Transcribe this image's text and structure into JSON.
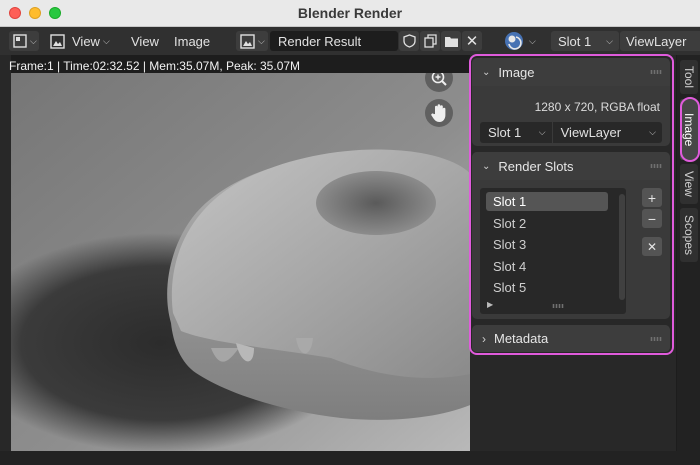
{
  "window": {
    "title": "Blender Render"
  },
  "header": {
    "view_menu": "View",
    "view_label": "View",
    "image_menu": "Image",
    "image_name": "Render Result",
    "slot": "Slot 1",
    "layer": "ViewLayer"
  },
  "status": {
    "text": "Frame:1 | Time:02:32.52 | Mem:35.07M, Peak: 35.07M"
  },
  "sidebar": {
    "tabs": [
      "Tool",
      "Image",
      "View",
      "Scopes"
    ],
    "active_tab": "Image",
    "image_panel": {
      "title": "Image",
      "info": "1280 x 720,  RGBA float",
      "slot": "Slot 1",
      "layer": "ViewLayer"
    },
    "render_slots_panel": {
      "title": "Render Slots",
      "slots": [
        "Slot 1",
        "Slot 2",
        "Slot 3",
        "Slot 4",
        "Slot 5"
      ],
      "active_slot": "Slot 1"
    },
    "metadata_panel": {
      "title": "Metadata"
    }
  },
  "colors": {
    "highlight": "#e05bdc",
    "header_bg": "#303030",
    "panel_bg": "#3a3a3a",
    "accent_blue": "#4772b3"
  },
  "icons": [
    "image-editor-icon",
    "image-icon",
    "browse-image-icon",
    "shield-icon",
    "duplicate-icon",
    "folder-icon",
    "close-icon",
    "render-slot-icon",
    "zoom-icon",
    "hand-pan-icon",
    "plus-icon",
    "minus-icon",
    "x-icon",
    "grip-icon",
    "triangle-expand-icon"
  ]
}
